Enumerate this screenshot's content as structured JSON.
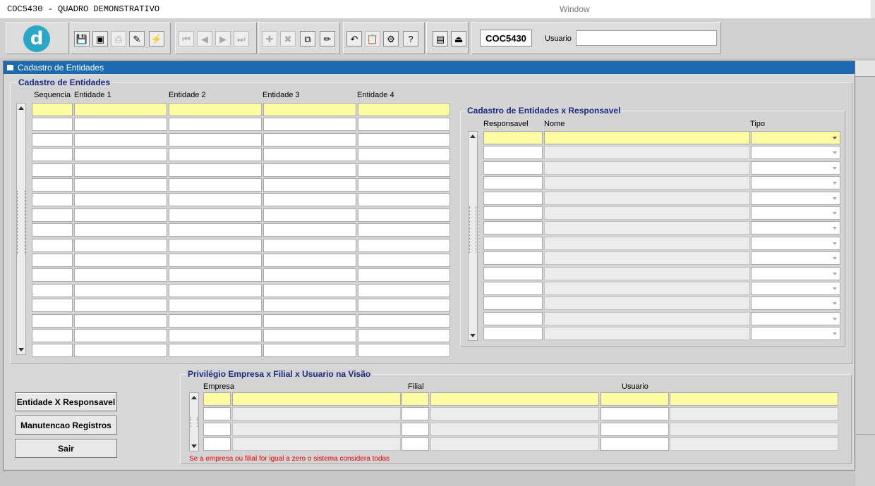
{
  "window": {
    "app_title": "COC5430 - QUADRO DEMONSTRATIVO",
    "title": "Window"
  },
  "toolbar": {
    "logo_letter": "d",
    "form_code": "COC5430",
    "usuario_label": "Usuario",
    "usuario_value": "",
    "buttons": [
      {
        "icon": "save-icon",
        "glyph": "💾",
        "enabled": true
      },
      {
        "icon": "screen-icon",
        "glyph": "▣",
        "enabled": true
      },
      {
        "icon": "print-icon",
        "glyph": "⎙",
        "enabled": false
      },
      {
        "icon": "query-icon",
        "glyph": "✎",
        "enabled": true
      },
      {
        "icon": "execute-query-icon",
        "glyph": "⚡",
        "enabled": true
      },
      {
        "icon": "first-record-icon",
        "glyph": "⏮",
        "enabled": false
      },
      {
        "icon": "previous-record-icon",
        "glyph": "◀",
        "enabled": false
      },
      {
        "icon": "next-record-icon",
        "glyph": "▶",
        "enabled": false
      },
      {
        "icon": "last-record-icon",
        "glyph": "⏭",
        "enabled": false
      },
      {
        "icon": "insert-record-icon",
        "glyph": "✚",
        "enabled": false
      },
      {
        "icon": "delete-record-icon",
        "glyph": "✖",
        "enabled": false
      },
      {
        "icon": "duplicate-record-icon",
        "glyph": "⧉",
        "enabled": true
      },
      {
        "icon": "clear-record-icon",
        "glyph": "✏",
        "enabled": true
      },
      {
        "icon": "undo-icon",
        "glyph": "↶",
        "enabled": true
      },
      {
        "icon": "clipboard-icon",
        "glyph": "📋",
        "enabled": false
      },
      {
        "icon": "tools-icon",
        "glyph": "⚙",
        "enabled": true
      },
      {
        "icon": "help-icon",
        "glyph": "?",
        "enabled": true
      },
      {
        "icon": "menu-icon",
        "glyph": "▤",
        "enabled": true
      },
      {
        "icon": "exit-icon",
        "glyph": "⏏",
        "enabled": true
      }
    ]
  },
  "main": {
    "title": "Cadastro de Entidades",
    "entidades": {
      "title": "Cadastro de Entidades",
      "columns": [
        "Sequencia",
        "Entidade 1",
        "Entidade 2",
        "Entidade 3",
        "Entidade 4"
      ],
      "visible_rows": 17
    },
    "responsavel": {
      "title": "Cadastro de Entidades x Responsavel",
      "columns": [
        "Responsavel",
        "Nome",
        "Tipo"
      ],
      "visible_rows": 14
    },
    "privilegio": {
      "title": "Privilégio Empresa x Filial x Usuario na Visão",
      "columns": [
        "Empresa",
        "Filial",
        "Usuario"
      ],
      "visible_rows": 4,
      "note": "Se a empresa ou filial for igual a zero o sistema considera todas"
    },
    "buttons": {
      "entidade_responsavel": "Entidade X Responsavel",
      "manutencao_registros": "Manutencao Registros",
      "sair": "Sair"
    }
  }
}
